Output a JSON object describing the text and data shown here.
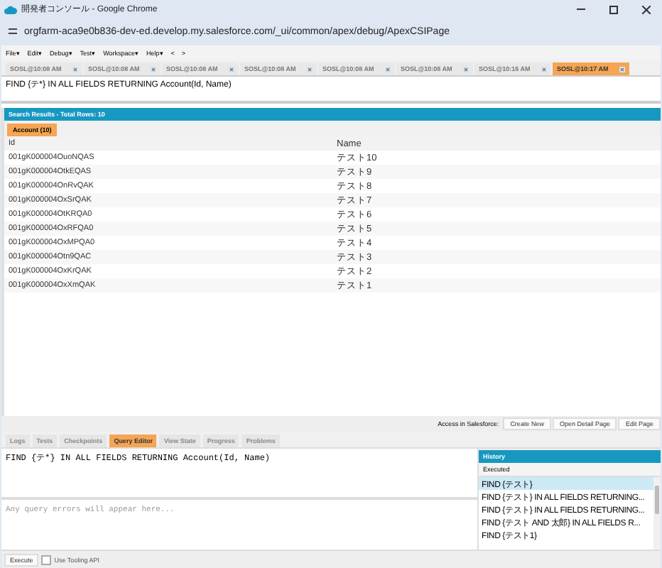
{
  "window": {
    "title": "開発者コンソール - Google Chrome",
    "url": "orgfarm-aca9e0b836-dev-ed.develop.my.salesforce.com/_ui/common/apex/debug/ApexCSIPage"
  },
  "menu": [
    {
      "label": "File",
      "caret": "▾"
    },
    {
      "label": "Edit",
      "caret": "▾"
    },
    {
      "label": "Debug",
      "caret": "▾"
    },
    {
      "label": "Test",
      "caret": "▾"
    },
    {
      "label": "Workspace",
      "caret": "▾"
    },
    {
      "label": "Help",
      "caret": "▾"
    },
    {
      "label": "<"
    },
    {
      "label": ">"
    }
  ],
  "tabs": [
    {
      "label": "SOSL@10:08 AM",
      "selected": false
    },
    {
      "label": "SOSL@10:08 AM",
      "selected": false
    },
    {
      "label": "SOSL@10:08 AM",
      "selected": false
    },
    {
      "label": "SOSL@10:08 AM",
      "selected": false
    },
    {
      "label": "SOSL@10:08 AM",
      "selected": false
    },
    {
      "label": "SOSL@10:08 AM",
      "selected": false
    },
    {
      "label": "SOSL@10:16 AM",
      "selected": false
    },
    {
      "label": "SOSL@10:17 AM",
      "selected": true
    }
  ],
  "query": "FIND {テ*} IN ALL FIELDS RETURNING Account(Id, Name)",
  "results": {
    "title": "Search Results - Total Rows: 10",
    "object_tab": "Account (10)",
    "columns": [
      "Id",
      "Name"
    ],
    "rows": [
      [
        "001gK000004OuoNQAS",
        "テスト10"
      ],
      [
        "001gK000004OtkEQAS",
        "テスト9"
      ],
      [
        "001gK000004OnRvQAK",
        "テスト8"
      ],
      [
        "001gK000004OxSrQAK",
        "テスト7"
      ],
      [
        "001gK000004OtKRQA0",
        "テスト6"
      ],
      [
        "001gK000004OxRFQA0",
        "テスト5"
      ],
      [
        "001gK000004OxMPQA0",
        "テスト4"
      ],
      [
        "001gK000004Otn9QAC",
        "テスト3"
      ],
      [
        "001gK000004OxKrQAK",
        "テスト2"
      ],
      [
        "001gK000004OxXmQAK",
        "テスト1"
      ]
    ]
  },
  "access": {
    "label": "Access in Salesforce:",
    "buttons": [
      {
        "label": "Create New",
        "disabled": false
      },
      {
        "label": "Open Detail Page",
        "disabled": false
      },
      {
        "label": "Edit Page",
        "disabled": false
      }
    ]
  },
  "bottom_tabs": [
    {
      "label": "Logs",
      "selected": false
    },
    {
      "label": "Tests",
      "selected": false
    },
    {
      "label": "Checkpoints",
      "selected": false
    },
    {
      "label": "Query Editor",
      "selected": true
    },
    {
      "label": "View State",
      "selected": false
    },
    {
      "label": "Progress",
      "selected": false
    },
    {
      "label": "Problems",
      "selected": false
    }
  ],
  "editor": {
    "value": "FIND {テ*} IN ALL FIELDS RETURNING Account(Id, Name)",
    "errors_placeholder": "Any query errors will appear here..."
  },
  "history": {
    "title": "History",
    "column": "Executed",
    "items": [
      {
        "label": "FIND {テスト}",
        "selected": true
      },
      {
        "label": "FIND {テスト} IN ALL FIELDS RETURNING...",
        "selected": false
      },
      {
        "label": "FIND {テスト} IN ALL FIELDS RETURNING...",
        "selected": false
      },
      {
        "label": "FIND {テスト AND 太郎} IN ALL FIELDS R...",
        "selected": false
      },
      {
        "label": "FIND {テスト1}",
        "selected": false
      }
    ]
  },
  "execute": {
    "button": "Execute",
    "tooling_label": "Use Tooling API",
    "tooling_checked": false
  }
}
